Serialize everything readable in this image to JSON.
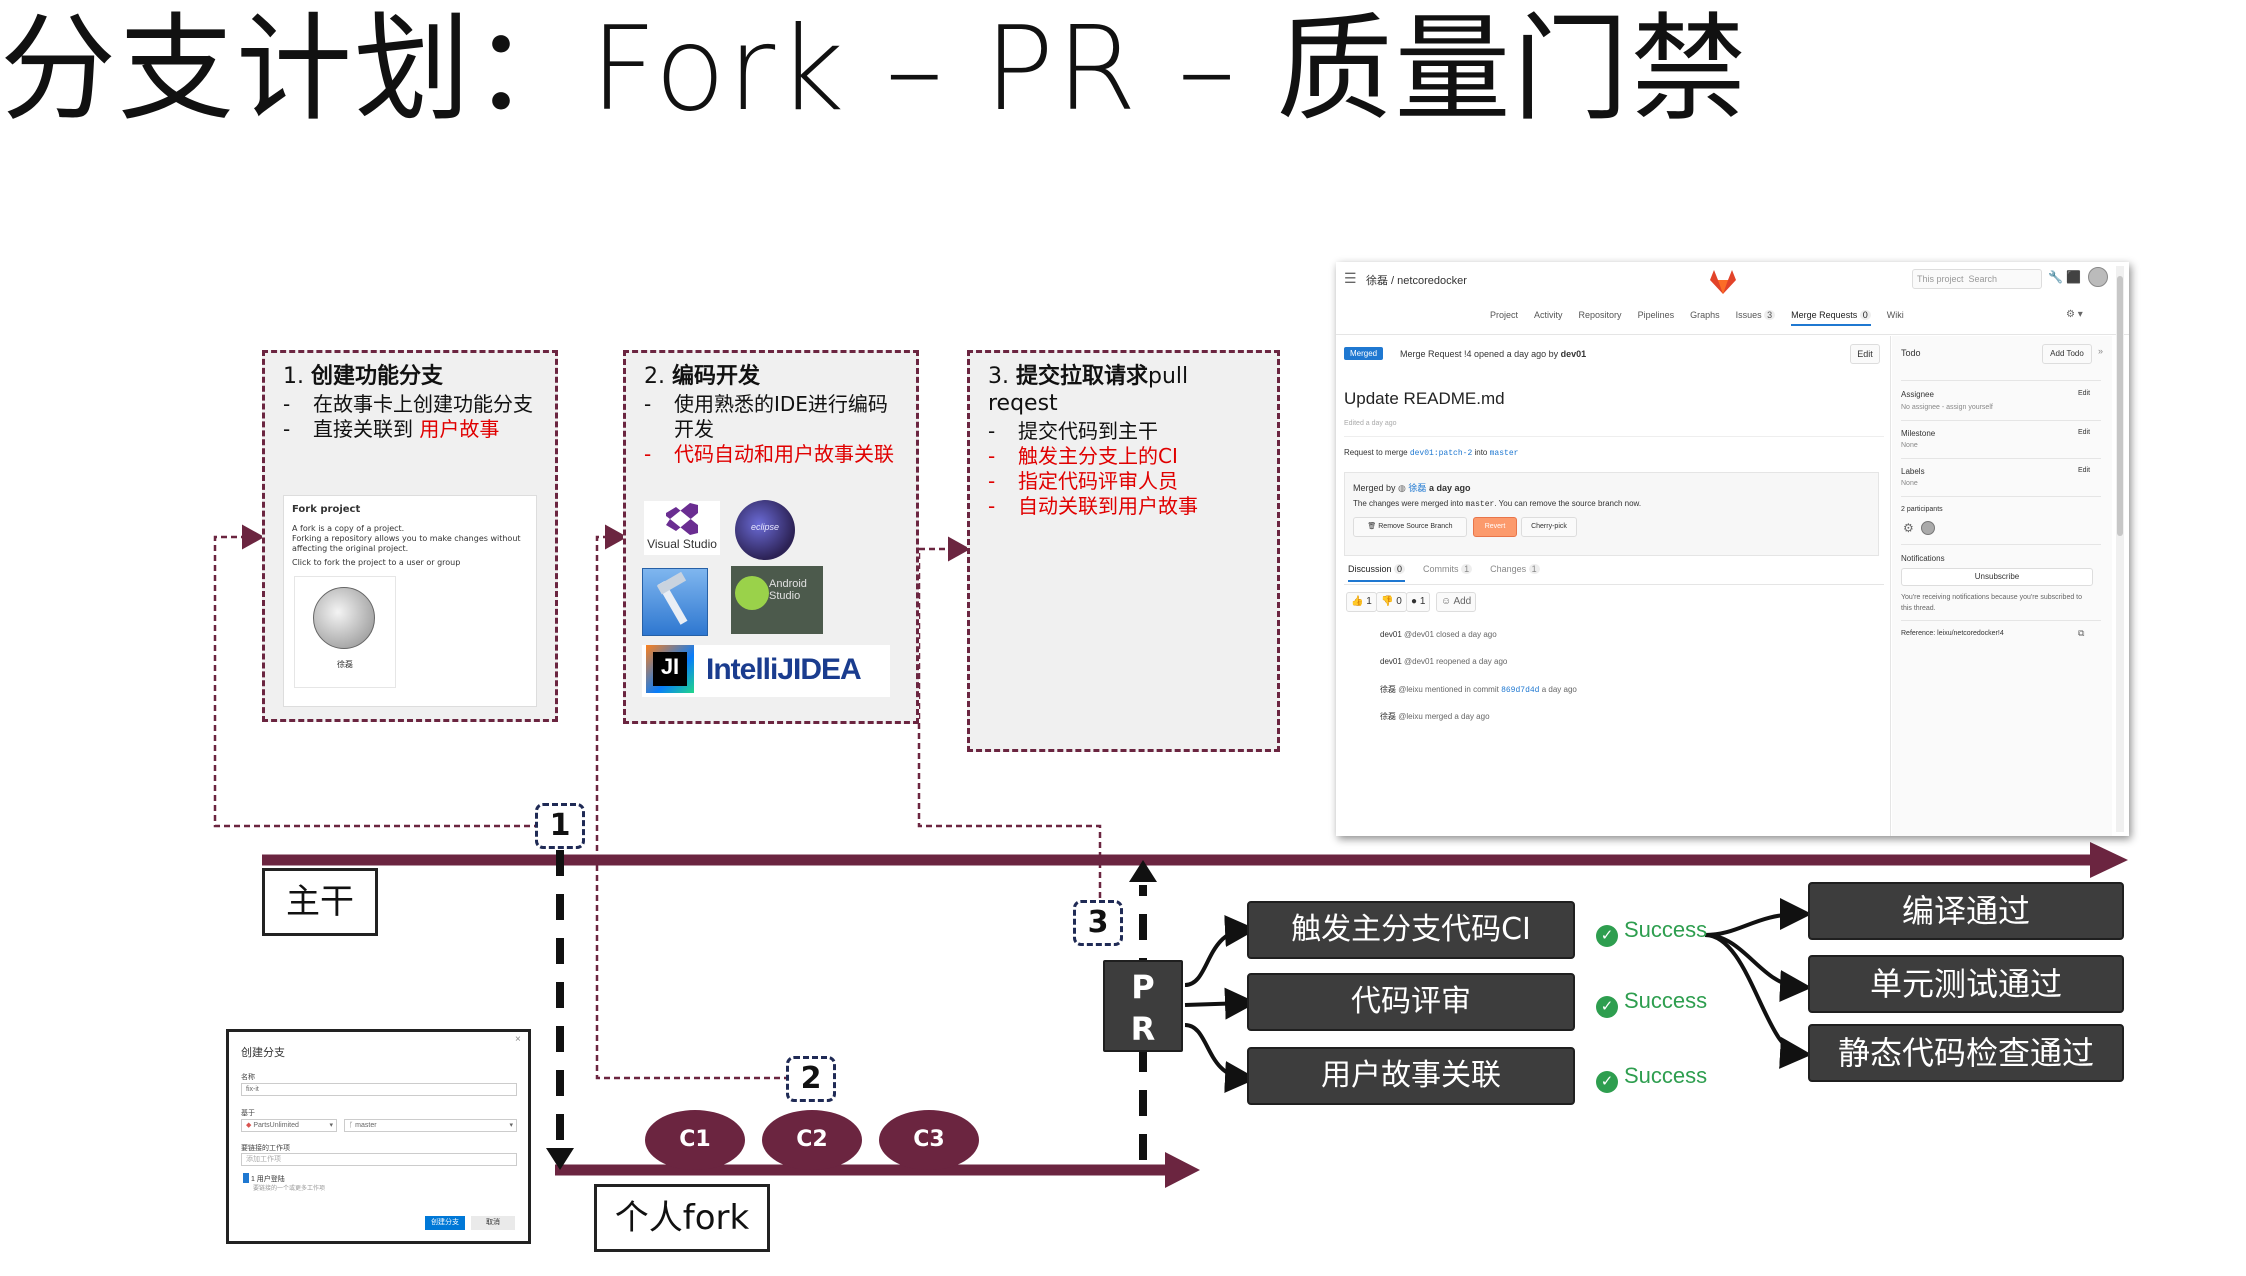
{
  "title": "分支计划：Fork – PR – 质量门禁",
  "steps": [
    {
      "heading_prefix": "1. ",
      "heading_bold": "创建功能分支",
      "heading_suffix": "",
      "bullets": [
        {
          "text": "在故事卡上创建功能分支",
          "red": false
        },
        {
          "text_a": "直接关联到 ",
          "text_b": "用户故事"
        }
      ]
    },
    {
      "heading_prefix": "2. ",
      "heading_bold": "编码开发",
      "heading_suffix": "",
      "bullets": [
        {
          "text": "使用熟悉的IDE进行编码开发",
          "red": false
        },
        {
          "text": "代码自动和用户故事关联",
          "red": true
        }
      ]
    },
    {
      "heading_prefix": "3. ",
      "heading_bold": "提交拉取请求",
      "heading_suffix": "pull reqest",
      "bullets": [
        {
          "text": "提交代码到主干",
          "red": false
        },
        {
          "text": "触发主分支上的CI",
          "red": true
        },
        {
          "text": "指定代码评审人员",
          "red": true
        },
        {
          "text": "自动关联到用户故事",
          "red": true
        }
      ]
    }
  ],
  "fork_card": {
    "title": "Fork project",
    "line1": "A fork is a copy of a project.",
    "line2": "Forking a repository allows you to make changes without affecting the original project.",
    "line3": "Click to fork the project to a user or group",
    "user": "徐磊"
  },
  "ide_logos": {
    "visual_studio": "Visual Studio",
    "eclipse": "eclipse",
    "android_studio": "Android Studio",
    "intellij": "IntelliJIDEA"
  },
  "labels": {
    "trunk": "主干",
    "personal_fork": "个人fork",
    "pr": [
      "P",
      "R"
    ]
  },
  "step_numbers": [
    "1",
    "2",
    "3"
  ],
  "commits": [
    "C1",
    "C2",
    "C3"
  ],
  "pr_actions": [
    "触发主分支代码CI",
    "代码评审",
    "用户故事关联"
  ],
  "success_label": "Success",
  "gates": [
    "编译通过",
    "单元测试通过",
    "静态代码检查通过"
  ],
  "gitlab": {
    "breadcrumb": "徐磊 / netcoredocker",
    "search_scope": "This project",
    "search_placeholder": "Search",
    "nav": [
      {
        "label": "Project"
      },
      {
        "label": "Activity"
      },
      {
        "label": "Repository"
      },
      {
        "label": "Pipelines"
      },
      {
        "label": "Graphs"
      },
      {
        "label": "Issues",
        "count": "3"
      },
      {
        "label": "Merge Requests",
        "count": "0"
      },
      {
        "label": "Wiki"
      }
    ],
    "status_badge": "Merged",
    "mr_meta": "Merge Request !4 opened a day ago by",
    "mr_author": "dev01",
    "edit": "Edit",
    "mr_title": "Update README.md",
    "edited": "Edited a day ago",
    "request_prefix": "Request to merge",
    "source_branch": "dev01:patch-2",
    "into": "into",
    "target_branch": "master",
    "merged_by_prefix": "Merged by",
    "merged_by_user": "徐磊",
    "merged_by_time": "a day ago",
    "merged_note_a": "The changes were merged into",
    "merged_note_branch": "master",
    "merged_note_b": ". You can remove the source branch now.",
    "btn_remove": "Remove Source Branch",
    "btn_revert": "Revert",
    "btn_cherry": "Cherry-pick",
    "tabs": [
      {
        "label": "Discussion",
        "count": "0"
      },
      {
        "label": "Commits",
        "count": "1"
      },
      {
        "label": "Changes",
        "count": "1"
      }
    ],
    "reactions": [
      {
        "icon": "thumbs-up-icon",
        "glyph": "👍",
        "count": "1"
      },
      {
        "icon": "thumbs-down-icon",
        "glyph": "👎",
        "count": "0"
      },
      {
        "icon": "emoji-icon",
        "glyph": "●",
        "count": "1"
      }
    ],
    "add_reaction": "Add",
    "activity": [
      {
        "user": "dev01",
        "text": "@dev01 closed a day ago",
        "link": ""
      },
      {
        "user": "dev01",
        "text": "@dev01 reopened a day ago",
        "link": ""
      },
      {
        "user": "徐磊",
        "text": "@leixu mentioned in commit",
        "link": "869d7d4d",
        "suffix": "a day ago"
      },
      {
        "user": "徐磊",
        "text": "@leixu merged a day ago",
        "link": ""
      }
    ],
    "sidebar": {
      "todo": "Todo",
      "add_todo": "Add Todo",
      "assignee": "Assignee",
      "assignee_value": "No assignee - assign yourself",
      "milestone": "Milestone",
      "milestone_value": "None",
      "labels": "Labels",
      "labels_value": "None",
      "participants": "2 participants",
      "notifications": "Notifications",
      "unsubscribe": "Unsubscribe",
      "notif_note": "You're receiving notifications because you're subscribed to this thread.",
      "reference": "Reference: leixu/netcoredocker!4",
      "edit": "Edit"
    }
  },
  "dialog": {
    "title": "创建分支",
    "name_label": "名称",
    "name_value": "fix-it",
    "based_on_label": "基于",
    "repo": "PartsUnlimited",
    "branch": "master",
    "work_item_label": "要链接的工作项",
    "work_item_placeholder": "添加工作项",
    "linked_item": "1 用户登陆",
    "linked_item_sub": "要链接的一个或更多工作项",
    "create_button": "创建分支",
    "cancel_button": "取消"
  },
  "colors": {
    "maroon": "#6b2540",
    "dark_box": "#3d3d3d",
    "success": "#2e9e4f",
    "red_text": "#e00000",
    "number_box_border": "#1f2a55",
    "gitlab_orange": "#e24329"
  }
}
